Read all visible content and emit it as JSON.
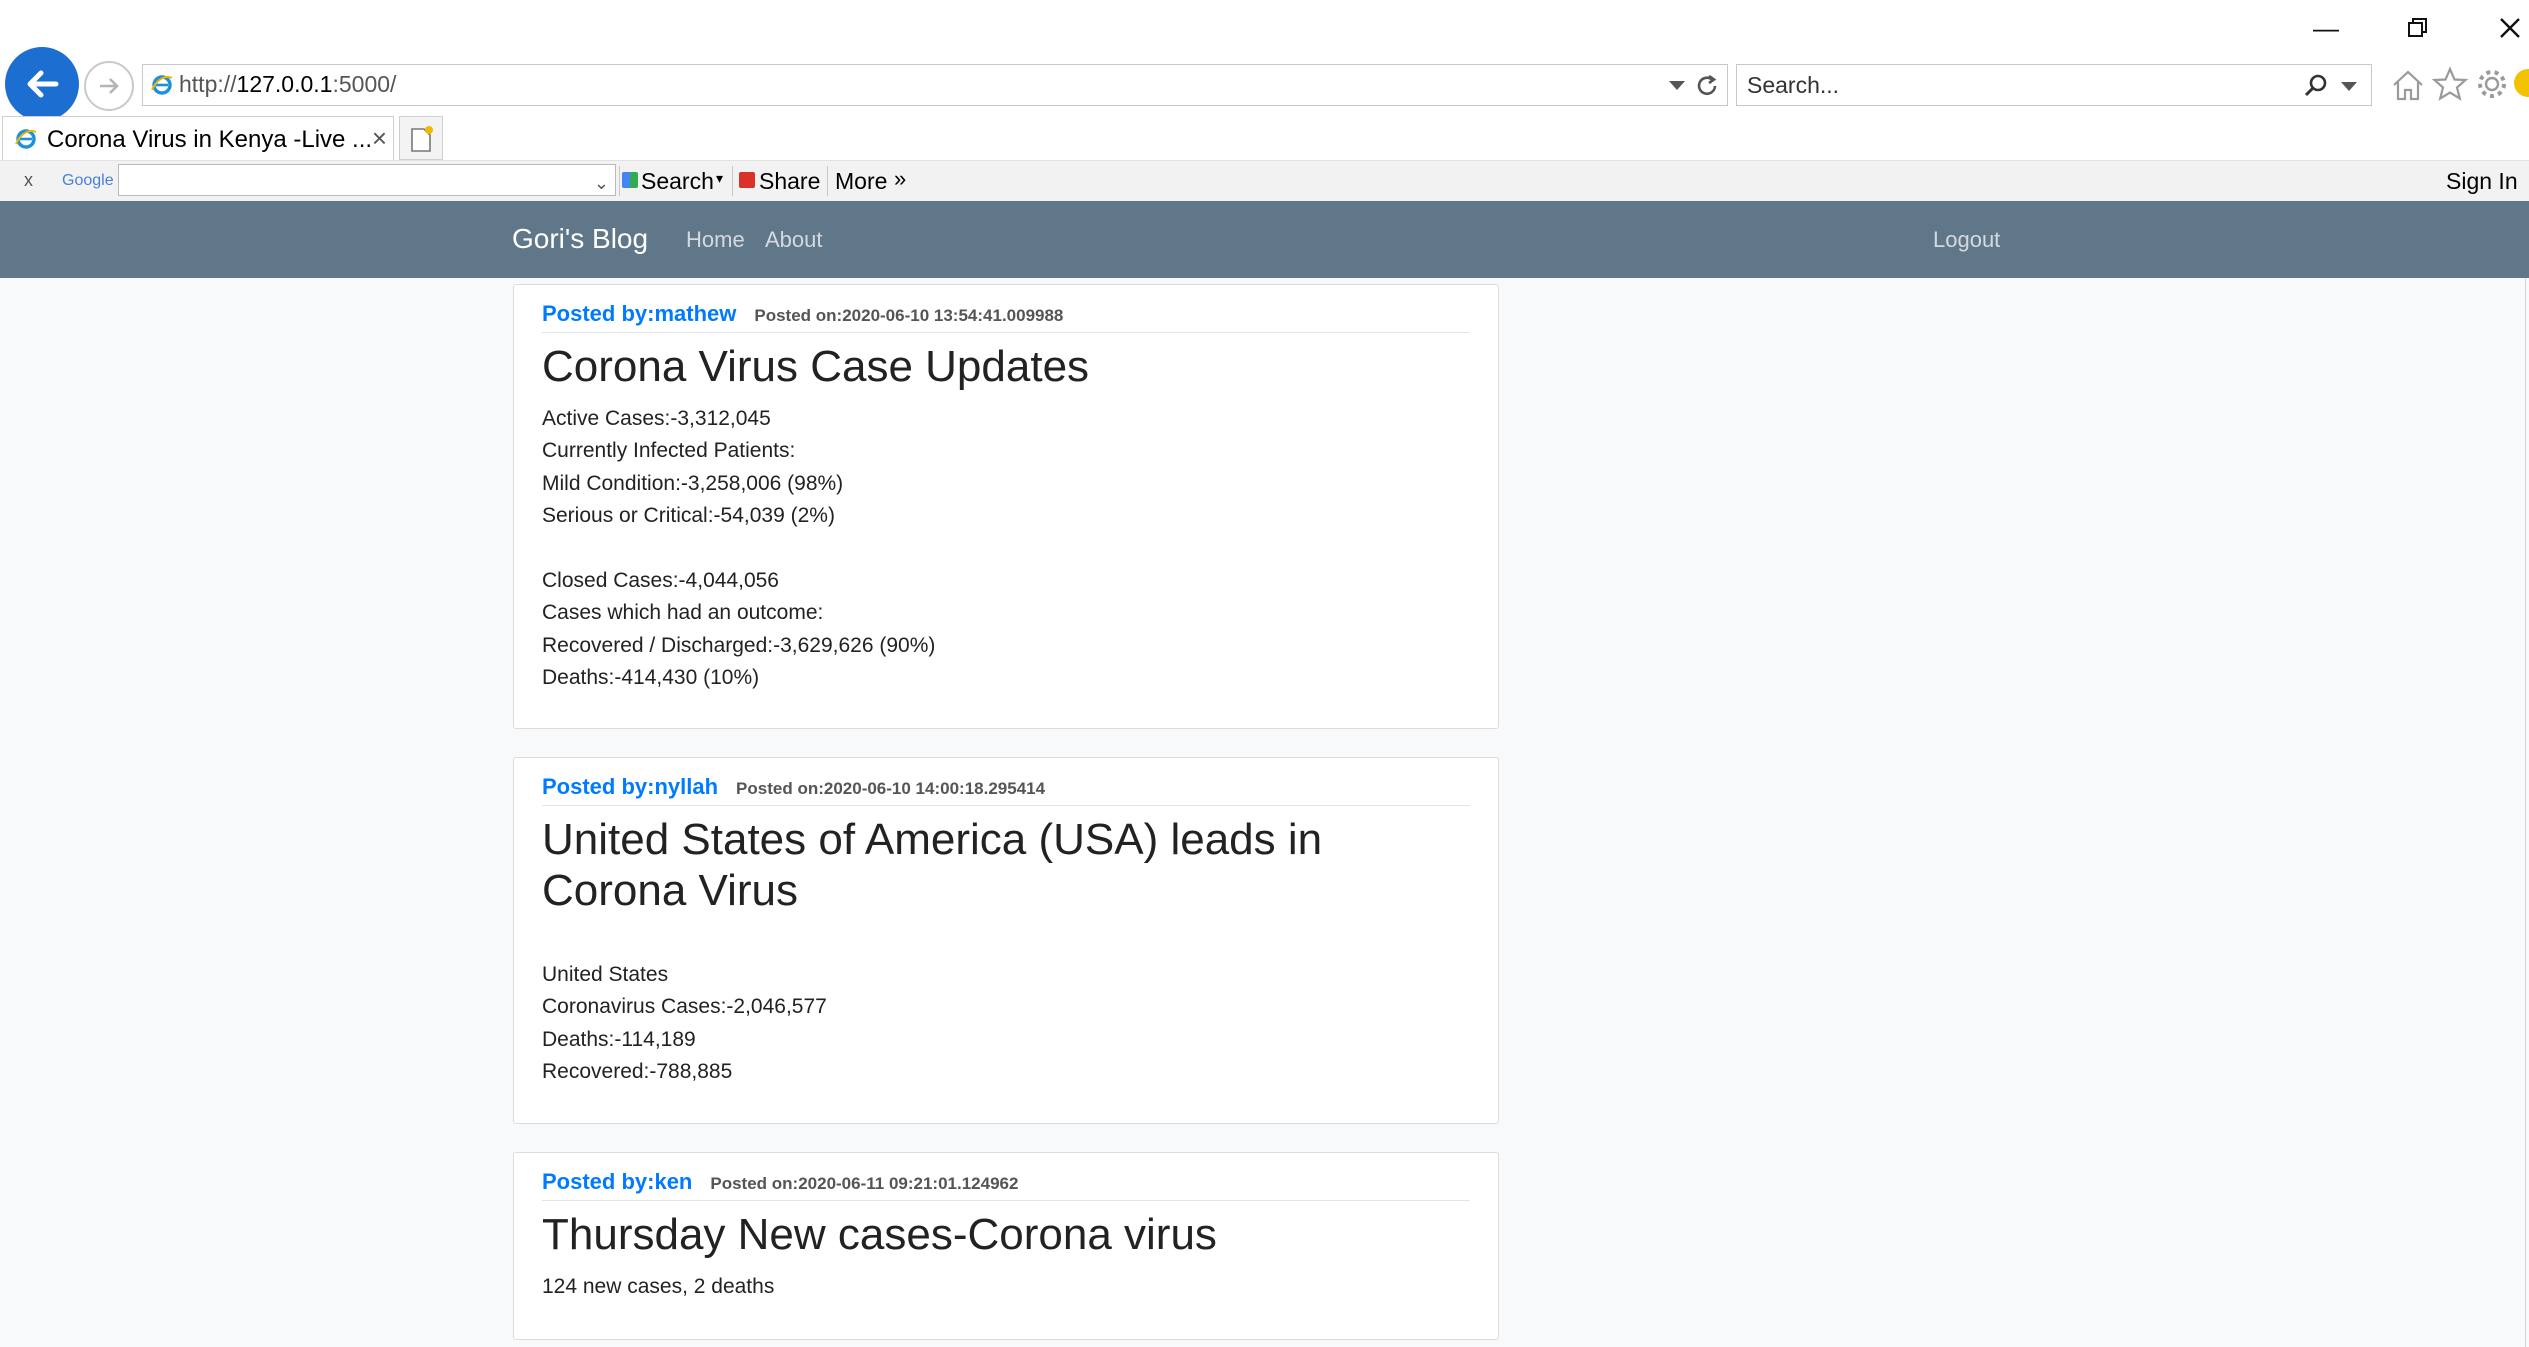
{
  "browser": {
    "url": "http://127.0.0.1:5000/",
    "url_prefix": "http://",
    "url_host": "127.0.0.1",
    "url_rest": ":5000/",
    "search_placeholder": "Search...",
    "tab_title": "Corona Virus in Kenya -Live ...",
    "toolbar": {
      "close": "x",
      "google_label": "Google",
      "search": "Search",
      "share": "Share",
      "more": "More",
      "more_glyph": "»",
      "sign_in": "Sign In"
    }
  },
  "navbar": {
    "brand": "Gori's Blog",
    "links": [
      "Home",
      "About"
    ],
    "logout": "Logout",
    "color": "#607789"
  },
  "posts": [
    {
      "author": "Posted by:mathew",
      "posted_on": "Posted on:2020-06-10 13:54:41.009988",
      "title": "Corona Virus Case Updates",
      "body": "Active Cases:-3,312,045\nCurrently Infected Patients:\nMild Condition:-3,258,006 (98%)\nSerious or Critical:-54,039 (2%)\n\nClosed Cases:-4,044,056\nCases which had an outcome:\nRecovered / Discharged:-3,629,626 (90%)\nDeaths:-414,430 (10%)"
    },
    {
      "author": "Posted by:nyllah",
      "posted_on": "Posted on:2020-06-10 14:00:18.295414",
      "title": "United States of America (USA) leads in Corona Virus",
      "body": "United States\nCoronavirus Cases:-2,046,577\nDeaths:-114,189\nRecovered:-788,885"
    },
    {
      "author": "Posted by:ken",
      "posted_on": "Posted on:2020-06-11 09:21:01.124962",
      "title": "Thursday New cases-Corona virus",
      "body": "124 new cases, 2 deaths"
    }
  ],
  "colors": {
    "accent": "#007bff",
    "ie_blue": "#1c6fd0"
  }
}
